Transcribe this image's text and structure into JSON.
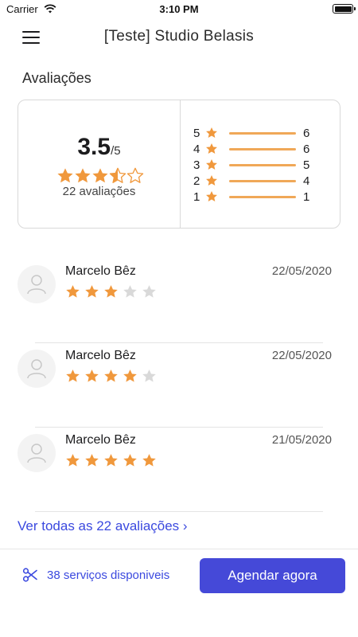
{
  "status": {
    "carrier": "Carrier",
    "time": "3:10 PM"
  },
  "header": {
    "title": "[Teste] Studio Belasis"
  },
  "section_title": "Avaliações",
  "summary": {
    "average": "3.5",
    "max": "/5",
    "average_rating": 3.5,
    "count_text": "22 avaliações",
    "distribution": [
      {
        "stars": "5",
        "count": "6"
      },
      {
        "stars": "4",
        "count": "6"
      },
      {
        "stars": "3",
        "count": "5"
      },
      {
        "stars": "2",
        "count": "4"
      },
      {
        "stars": "1",
        "count": "1"
      }
    ]
  },
  "reviews": [
    {
      "name": "Marcelo Bêz",
      "date": "22/05/2020",
      "rating": 3
    },
    {
      "name": "Marcelo Bêz",
      "date": "22/05/2020",
      "rating": 4
    },
    {
      "name": "Marcelo Bêz",
      "date": "21/05/2020",
      "rating": 5
    }
  ],
  "see_all_label": "Ver todas as 22 avaliações ›",
  "footer": {
    "services_label": "38 serviços disponiveis",
    "book_label": "Agendar agora"
  },
  "colors": {
    "accent": "#4549d8",
    "link": "#3b49df",
    "star": "#f0983c",
    "star_empty": "#d9d9d9"
  }
}
